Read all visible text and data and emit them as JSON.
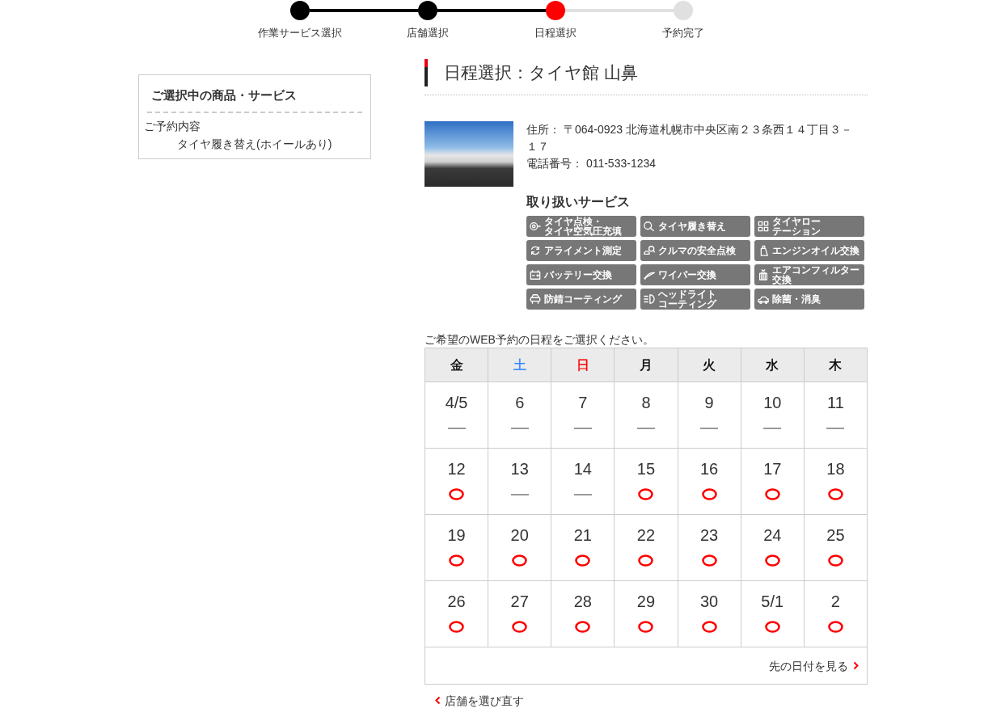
{
  "progress_steps": [
    {
      "label": "作業サービス選択",
      "completed": true,
      "current": false
    },
    {
      "label": "店舗選択",
      "completed": true,
      "current": false
    },
    {
      "label": "日程選択",
      "completed": false,
      "current": true
    },
    {
      "label": "予約完了",
      "completed": false,
      "current": false
    }
  ],
  "selection_panel": {
    "title": "ご選択中の商品・サービス",
    "section_label": "ご予約内容",
    "item": "タイヤ履き替え(ホイールあり)"
  },
  "store": {
    "title": "日程選択：タイヤ館 山鼻",
    "address": "住所： 〒064-0923 北海道札幌市中央区南２３条西１４丁目３－１７",
    "phone": "電話番号： 011-533-1234",
    "services_heading": "取り扱いサービス",
    "services": [
      {
        "lines": [
          "タイヤ点検・",
          "タイヤ空気圧充填"
        ]
      },
      {
        "lines": [
          "タイヤ履き替え"
        ]
      },
      {
        "lines": [
          "タイヤローテーション"
        ]
      },
      {
        "lines": [
          "アライメント測定"
        ]
      },
      {
        "lines": [
          "クルマの安全点検"
        ]
      },
      {
        "lines": [
          "エンジンオイル交換"
        ]
      },
      {
        "lines": [
          "バッテリー交換"
        ]
      },
      {
        "lines": [
          "ワイパー交換"
        ]
      },
      {
        "lines": [
          "エアコンフィルター交換"
        ]
      },
      {
        "lines": [
          "防錆コーティング"
        ]
      },
      {
        "lines": [
          "ヘッドライトコーティング"
        ]
      },
      {
        "lines": [
          "除菌・消臭"
        ]
      }
    ]
  },
  "schedule": {
    "instruction": "ご希望のWEB予約の日程をご選択ください。",
    "weekdays": [
      {
        "label": "金",
        "color": "#000000"
      },
      {
        "label": "土",
        "color": "#2f86ff"
      },
      {
        "label": "日",
        "color": "#ff0000"
      },
      {
        "label": "月",
        "color": "#000000"
      },
      {
        "label": "火",
        "color": "#000000"
      },
      {
        "label": "水",
        "color": "#000000"
      },
      {
        "label": "木",
        "color": "#000000"
      }
    ],
    "weeks": [
      [
        {
          "date": "4/5",
          "available": false
        },
        {
          "date": "6",
          "available": false
        },
        {
          "date": "7",
          "available": false
        },
        {
          "date": "8",
          "available": false
        },
        {
          "date": "9",
          "available": false
        },
        {
          "date": "10",
          "available": false
        },
        {
          "date": "11",
          "available": false
        }
      ],
      [
        {
          "date": "12",
          "available": true
        },
        {
          "date": "13",
          "available": false
        },
        {
          "date": "14",
          "available": false
        },
        {
          "date": "15",
          "available": true
        },
        {
          "date": "16",
          "available": true
        },
        {
          "date": "17",
          "available": true
        },
        {
          "date": "18",
          "available": true
        }
      ],
      [
        {
          "date": "19",
          "available": true
        },
        {
          "date": "20",
          "available": true
        },
        {
          "date": "21",
          "available": true
        },
        {
          "date": "22",
          "available": true
        },
        {
          "date": "23",
          "available": true
        },
        {
          "date": "24",
          "available": true
        },
        {
          "date": "25",
          "available": true
        }
      ],
      [
        {
          "date": "26",
          "available": true
        },
        {
          "date": "27",
          "available": true
        },
        {
          "date": "28",
          "available": true
        },
        {
          "date": "29",
          "available": true
        },
        {
          "date": "30",
          "available": true
        },
        {
          "date": "5/1",
          "available": true
        },
        {
          "date": "2",
          "available": true
        }
      ]
    ],
    "next_link": "先の日付を見る"
  },
  "back_link": "店舗を選び直す"
}
